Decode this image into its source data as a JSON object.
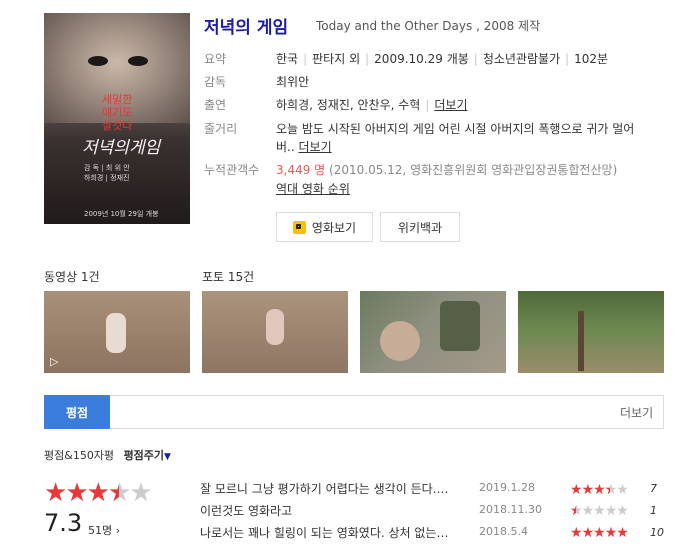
{
  "movie": {
    "title": "저녁의 게임",
    "subtitle": "Today and the Other Days , 2008 제작",
    "poster": {
      "tagline_lines": [
        "세밀한",
        "얘기도",
        "살것다"
      ],
      "title_text": "저녁의게임",
      "credits": [
        "감 독 | 최 위 안",
        "하희경 | 정재진",
        "2009년 10월 29일 개봉"
      ]
    }
  },
  "info": {
    "summary_label": "요약",
    "summary": [
      "한국",
      "판타지 외",
      "2009.10.29 개봉",
      "청소년관람불가",
      "102분"
    ],
    "director_label": "감독",
    "director": "최위안",
    "cast_label": "출연",
    "cast": "하희경, 정재진, 안찬우, 수혁",
    "cast_more": "더보기",
    "plot_label": "줄거리",
    "plot_line1": "오늘 밤도 시작된 아버지의 게임 어린 시절 아버지의 폭행으로 귀가 멀어",
    "plot_line2": "버..",
    "plot_more": "더보기",
    "audience_label": "누적관객수",
    "audience_count": "3,449 명",
    "audience_source": "(2010.05.12, 영화진흥위원회 영화관입장권통합전산망)",
    "ranking_link": "역대 영화 순위"
  },
  "buttons": {
    "watch": "영화보기",
    "wiki": "위키백과"
  },
  "media": {
    "video_label": "동영상 1건",
    "photo_label": "포토 15건"
  },
  "tabs": {
    "active": "평점",
    "more": "더보기"
  },
  "rating": {
    "header": "평점&150자평",
    "give_rating": "평점주기",
    "score": "7.3",
    "stars": 3.5,
    "count": "51명 ›",
    "reviews": [
      {
        "text": "잘 모르니 그냥 평가하기 어렵다는 생각이 든다.…",
        "date": "2019.1.28",
        "score": "7",
        "stars": 3.5
      },
      {
        "text": "이런것도 영화라고",
        "date": "2018.11.30",
        "score": "1",
        "stars": 0.5
      },
      {
        "text": "나로서는 꽤나 힐링이 되는 영화였다. 상처 없는…",
        "date": "2018.5.4",
        "score": "10",
        "stars": 5
      }
    ]
  },
  "colors": {
    "title": "#1a1aa6",
    "accent_tab": "#3b7ddd",
    "star": "#e63a3a",
    "audience": "#e55"
  }
}
